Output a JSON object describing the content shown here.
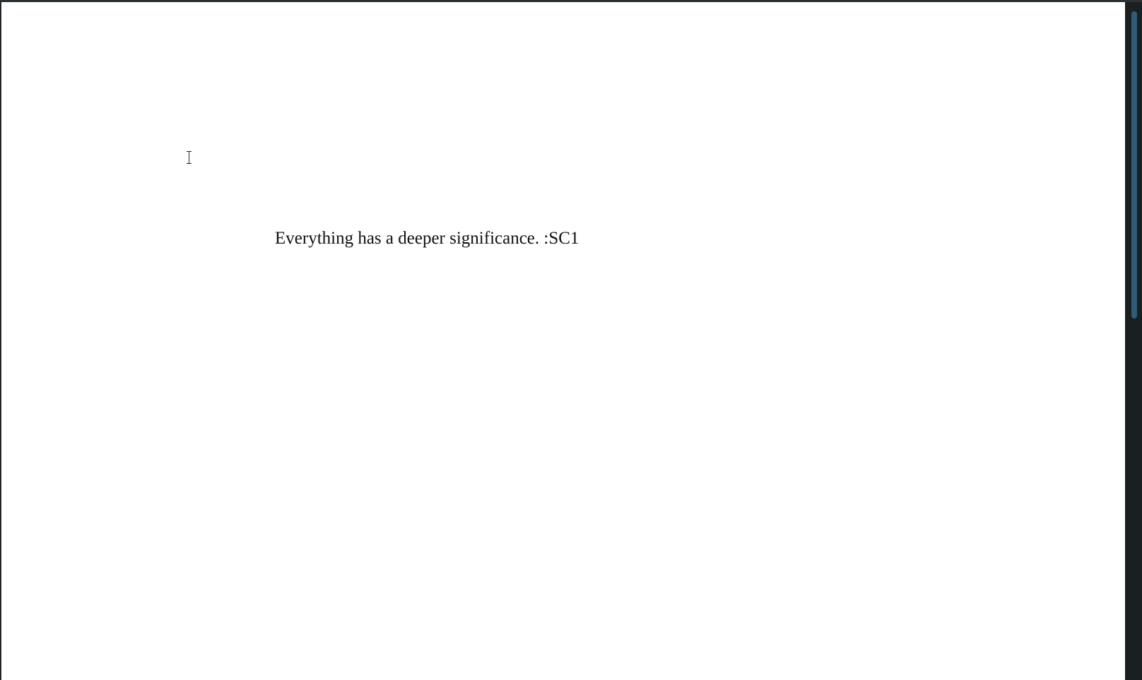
{
  "document": {
    "text": "Everything has a deeper significance. :SC1"
  },
  "icons": {
    "cursor": "text-cursor-icon",
    "scroll": "vertical-scrollbar"
  },
  "colors": {
    "page_background": "#ffffff",
    "window_background": "#1b2023",
    "scrollbar_thumb": "#2f5c78",
    "text": "#111111"
  }
}
